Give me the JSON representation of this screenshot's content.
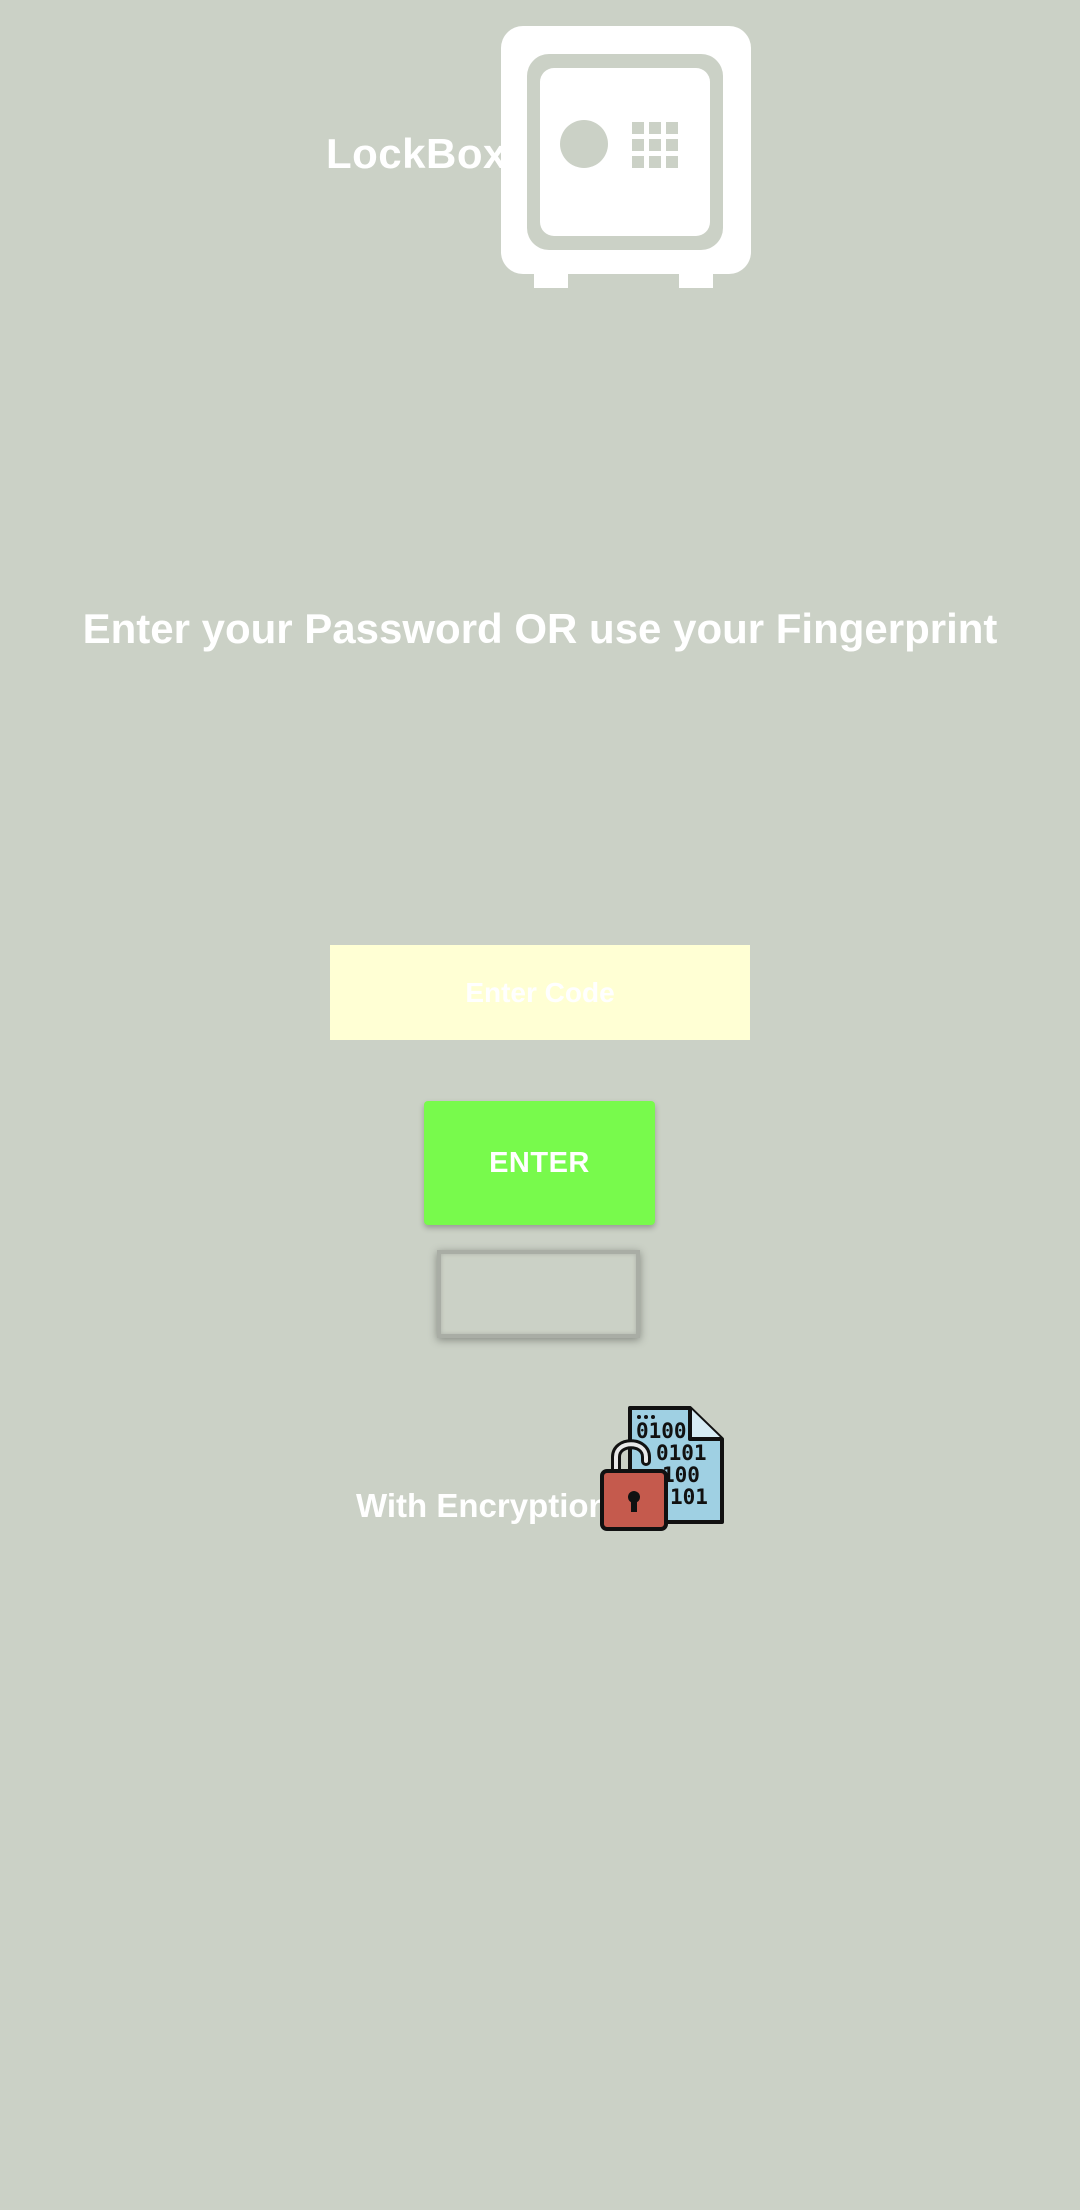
{
  "header": {
    "app_title": "LockBox",
    "logo_icon": "safe-icon"
  },
  "prompt": "Enter your Password OR use your Fingerprint",
  "code_input": {
    "placeholder": "Enter Code",
    "value": ""
  },
  "enter_button_label": "ENTER",
  "fingerprint_button_label": "",
  "encryption": {
    "label": "With Encryption",
    "icon": "encrypted-file-unlocked-icon"
  },
  "colors": {
    "background": "#cbd1c6",
    "input_background": "#ffffd4",
    "enter_button": "#78fa4c",
    "text": "#ffffff"
  }
}
